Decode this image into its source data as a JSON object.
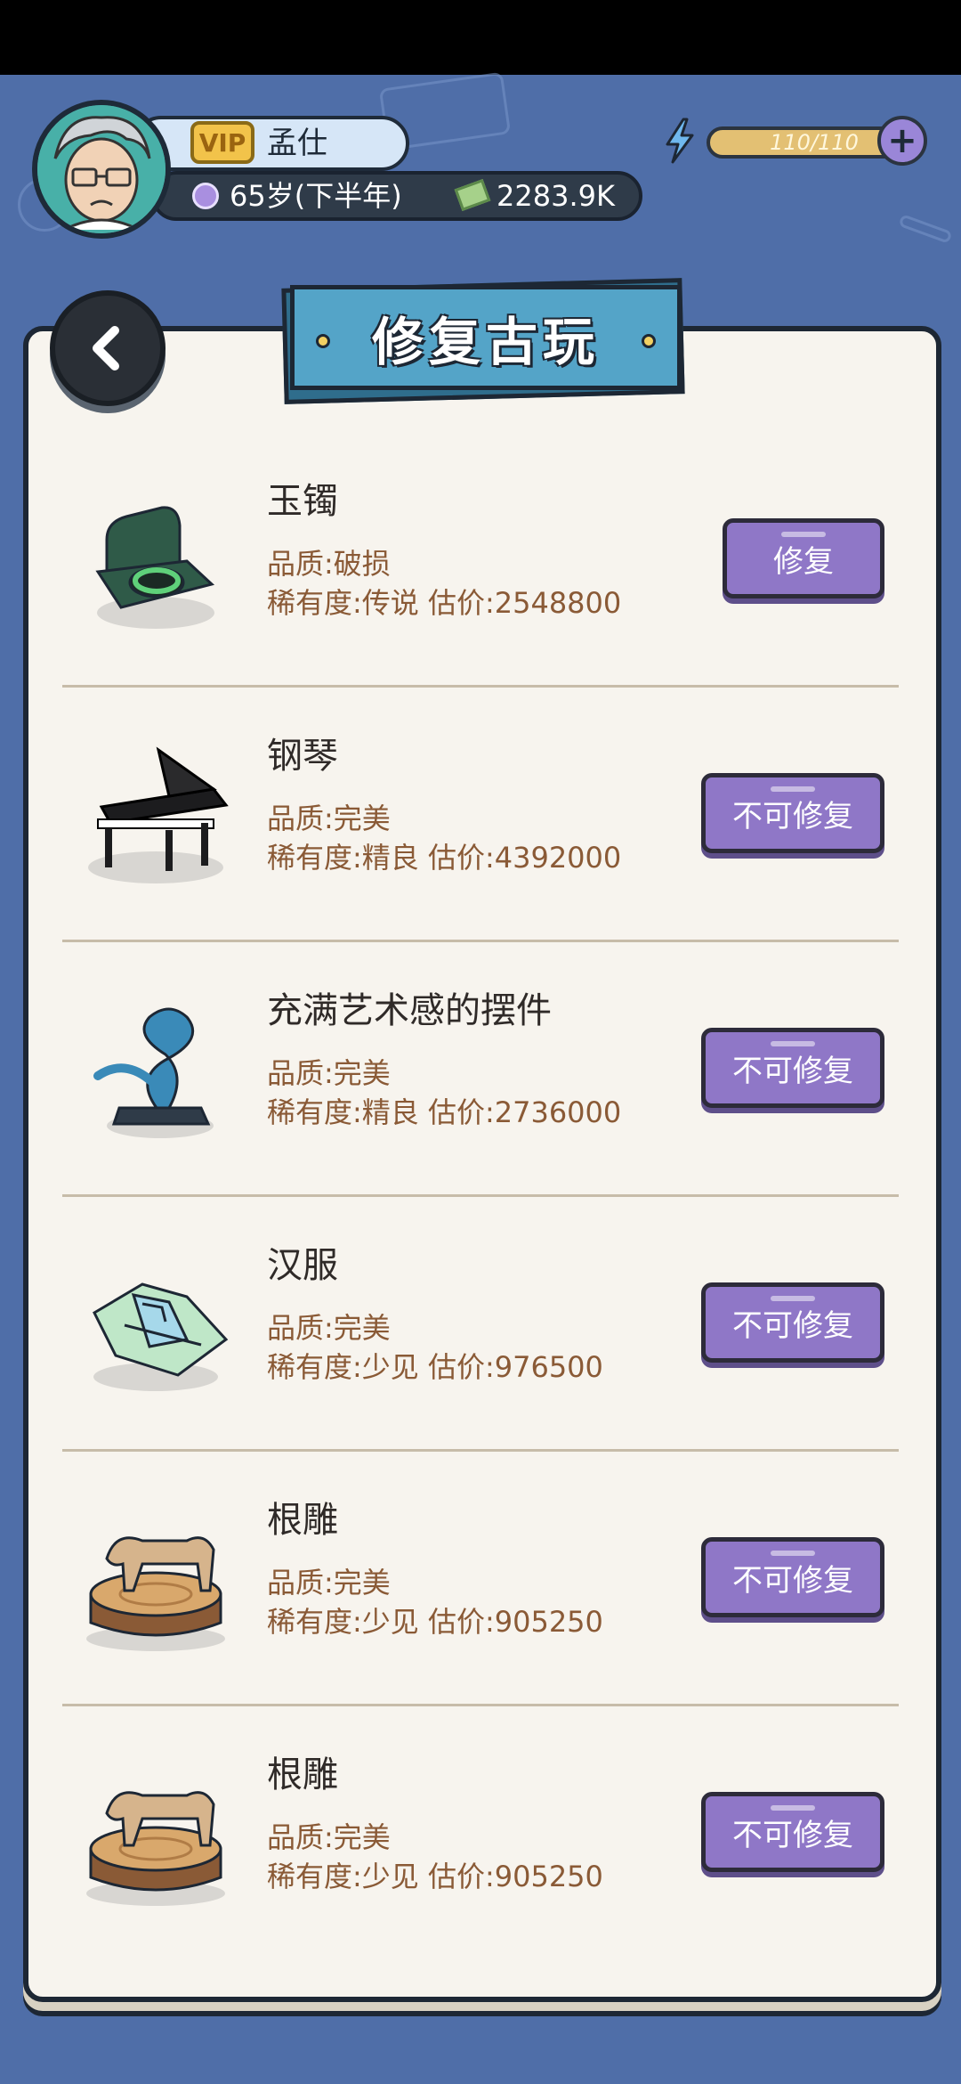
{
  "player": {
    "vip_label": "VIP",
    "name": "孟仕",
    "age": "65岁(下半年)",
    "cash": "2283.9K",
    "energy": "110/110"
  },
  "panel": {
    "title": "修复古玩"
  },
  "items": [
    {
      "name": "玉镯",
      "quality": "品质:破损",
      "rarity": "稀有度:传说 估价:2548800",
      "button": "修复"
    },
    {
      "name": "钢琴",
      "quality": "品质:完美",
      "rarity": "稀有度:精良 估价:4392000",
      "button": "不可修复"
    },
    {
      "name": "充满艺术感的摆件",
      "quality": "品质:完美",
      "rarity": "稀有度:精良 估价:2736000",
      "button": "不可修复"
    },
    {
      "name": "汉服",
      "quality": "品质:完美",
      "rarity": "稀有度:少见 估价:976500",
      "button": "不可修复"
    },
    {
      "name": "根雕",
      "quality": "品质:完美",
      "rarity": "稀有度:少见 估价:905250",
      "button": "不可修复"
    },
    {
      "name": "根雕",
      "quality": "品质:完美",
      "rarity": "稀有度:少见 估价:905250",
      "button": "不可修复"
    }
  ],
  "icons": {
    "back": "chevron-left-icon",
    "energy": "lightning-icon",
    "add": "plus-icon",
    "age": "clock-icon",
    "cash": "cash-icon"
  },
  "colors": {
    "background": "#4f6ea8",
    "panel": "#f7f4ee",
    "button": "#8f77c7",
    "banner": "#54a4c8",
    "text_detail": "#8a5a36"
  }
}
